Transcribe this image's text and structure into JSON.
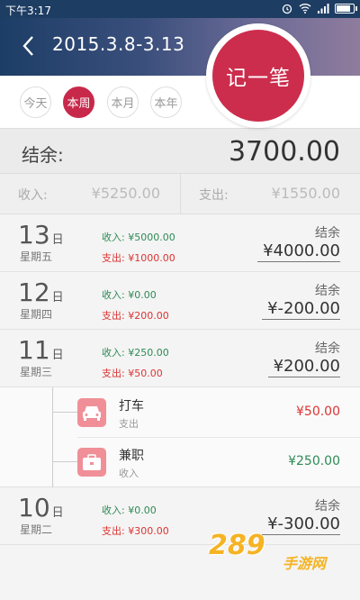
{
  "status_bar": {
    "time": "下午3:17"
  },
  "header": {
    "title": "2015.3.8-3.13"
  },
  "tabs": [
    {
      "label": "今天",
      "active": false
    },
    {
      "label": "本周",
      "active": true
    },
    {
      "label": "本月",
      "active": false
    },
    {
      "label": "本年",
      "active": false
    }
  ],
  "record_button": {
    "label": "记一笔"
  },
  "balance": {
    "label": "结余:",
    "value": "3700.00"
  },
  "summary": {
    "income_label": "收入:",
    "income_value": "¥5250.00",
    "expense_label": "支出:",
    "expense_value": "¥1550.00"
  },
  "days": [
    {
      "date": "13",
      "day_suffix": "日",
      "weekday": "星期五",
      "income": "收入: ¥5000.00",
      "expense": "支出: ¥1000.00",
      "net_label": "结余",
      "net": "¥4000.00"
    },
    {
      "date": "12",
      "day_suffix": "日",
      "weekday": "星期四",
      "income": "收入: ¥0.00",
      "expense": "支出: ¥200.00",
      "net_label": "结余",
      "net": "¥-200.00"
    },
    {
      "date": "11",
      "day_suffix": "日",
      "weekday": "星期三",
      "income": "收入: ¥250.00",
      "expense": "支出: ¥50.00",
      "net_label": "结余",
      "net": "¥200.00"
    },
    {
      "date": "10",
      "day_suffix": "日",
      "weekday": "星期二",
      "income": "收入: ¥0.00",
      "expense": "支出: ¥300.00",
      "net_label": "结余",
      "net": "¥-300.00"
    }
  ],
  "items": [
    {
      "name": "打车",
      "category": "支出",
      "amount": "¥50.00",
      "icon": "car-icon",
      "color": "#d33"
    },
    {
      "name": "兼职",
      "category": "收入",
      "amount": "¥250.00",
      "icon": "briefcase-icon",
      "color": "#2d8a55"
    }
  ],
  "watermark": {
    "number": "289",
    "site": "手游网"
  },
  "colors": {
    "accent": "#c8294b",
    "income": "#2d8a55",
    "expense": "#d33",
    "header": "#1c3e66"
  }
}
